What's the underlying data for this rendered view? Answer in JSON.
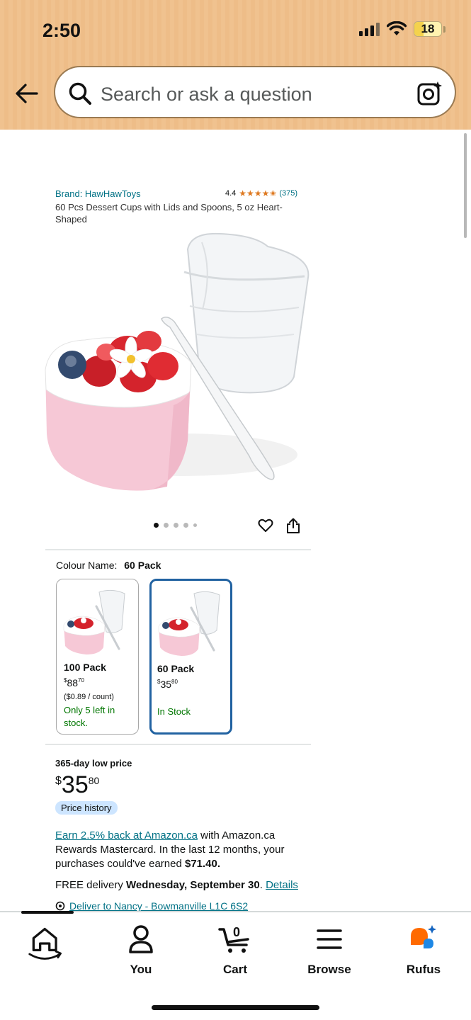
{
  "status_bar": {
    "time": "2:50",
    "battery": "18"
  },
  "header": {
    "search_placeholder": "Search or ask a question"
  },
  "product": {
    "brand": "Brand: HawHawToys",
    "rating": "4.4",
    "stars": "★★★★✬",
    "rating_count": "(375)",
    "title": "60 Pcs Dessert Cups with Lids and Spoons, 5 oz Heart-Shaped",
    "image_count": 5,
    "active_image": 1
  },
  "colour": {
    "label": "Colour Name:",
    "value": "60 Pack"
  },
  "variants": [
    {
      "name": "100 Pack",
      "price_whole": "88",
      "price_frac": "70",
      "currency": "$",
      "unit_price": "($0.89 / count)",
      "stock": "Only 5 left in stock.",
      "selected": false
    },
    {
      "name": "60 Pack",
      "price_whole": "35",
      "price_frac": "80",
      "currency": "$",
      "unit_price": "",
      "stock": "In Stock",
      "selected": true
    }
  ],
  "pricing": {
    "low_label": "365-day low price",
    "currency": "$",
    "whole": "35",
    "frac": "80",
    "history_label": "Price history"
  },
  "rewards": {
    "link": "Earn 2.5% back at Amazon.ca",
    "text": " with Amazon.ca Rewards Mastercard. In the last 12 months, your purchases could've earned ",
    "amount": "$71.40."
  },
  "delivery": {
    "prefix": "FREE delivery ",
    "date": "Wednesday, September 30",
    "sep": ". ",
    "details": "Details",
    "deliver_to": "Deliver to Nancy - Bowmanville L1C 6S2"
  },
  "bottom_nav": {
    "items": [
      {
        "label": ""
      },
      {
        "label": "You"
      },
      {
        "label": "Cart",
        "badge": "0"
      },
      {
        "label": "Browse"
      },
      {
        "label": "Rufus"
      }
    ]
  },
  "colors": {
    "accent_link": "#007185",
    "in_stock": "#007600",
    "selected_border": "#2162a1",
    "header_bg": "#f0c28f"
  }
}
